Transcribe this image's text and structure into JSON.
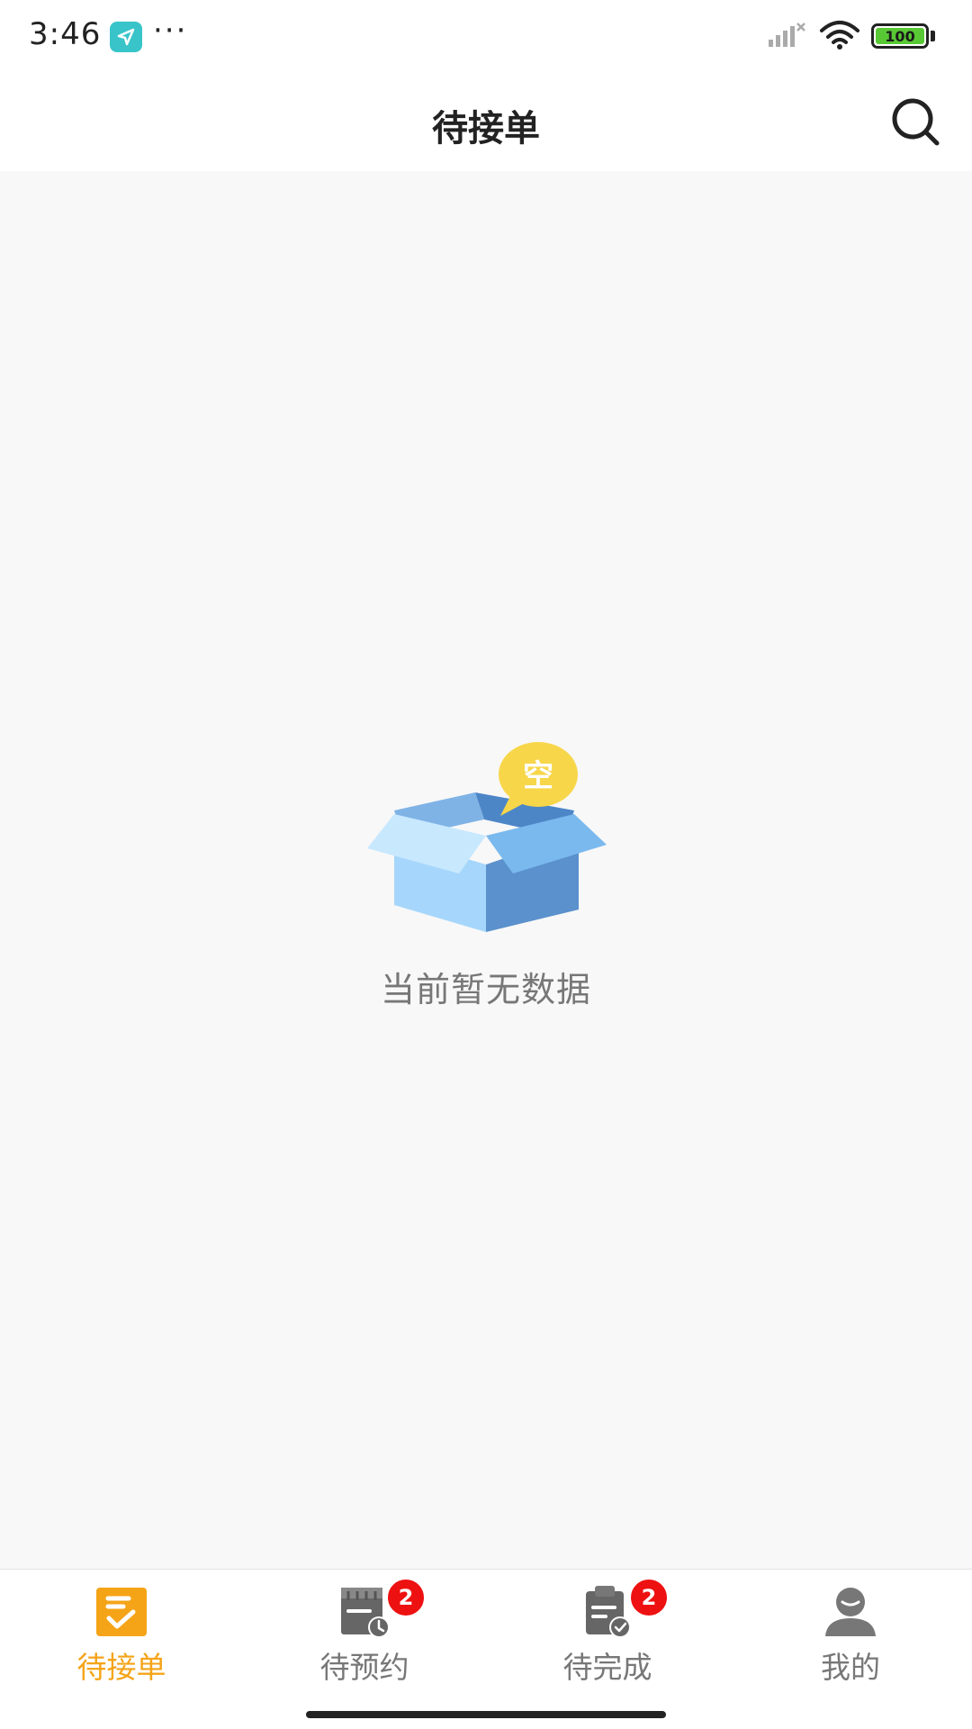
{
  "status_bar": {
    "time": "3:46",
    "dots": "···",
    "battery": "100"
  },
  "header": {
    "title": "待接单"
  },
  "empty_state": {
    "badge_text": "空",
    "message": "当前暂无数据"
  },
  "tabs": [
    {
      "label": "待接单",
      "icon": "clipboard-check-icon",
      "active": true
    },
    {
      "label": "待预约",
      "icon": "calendar-clock-icon",
      "badge": "2"
    },
    {
      "label": "待完成",
      "icon": "clipboard-done-icon",
      "badge": "2"
    },
    {
      "label": "我的",
      "icon": "user-icon"
    }
  ],
  "colors": {
    "accent": "#f5a418",
    "badge": "#ee1111",
    "tab_inactive": "#777777",
    "box_light": "#a6d6fb",
    "box_dark": "#5b91cc",
    "bubble": "#f7d64a"
  }
}
